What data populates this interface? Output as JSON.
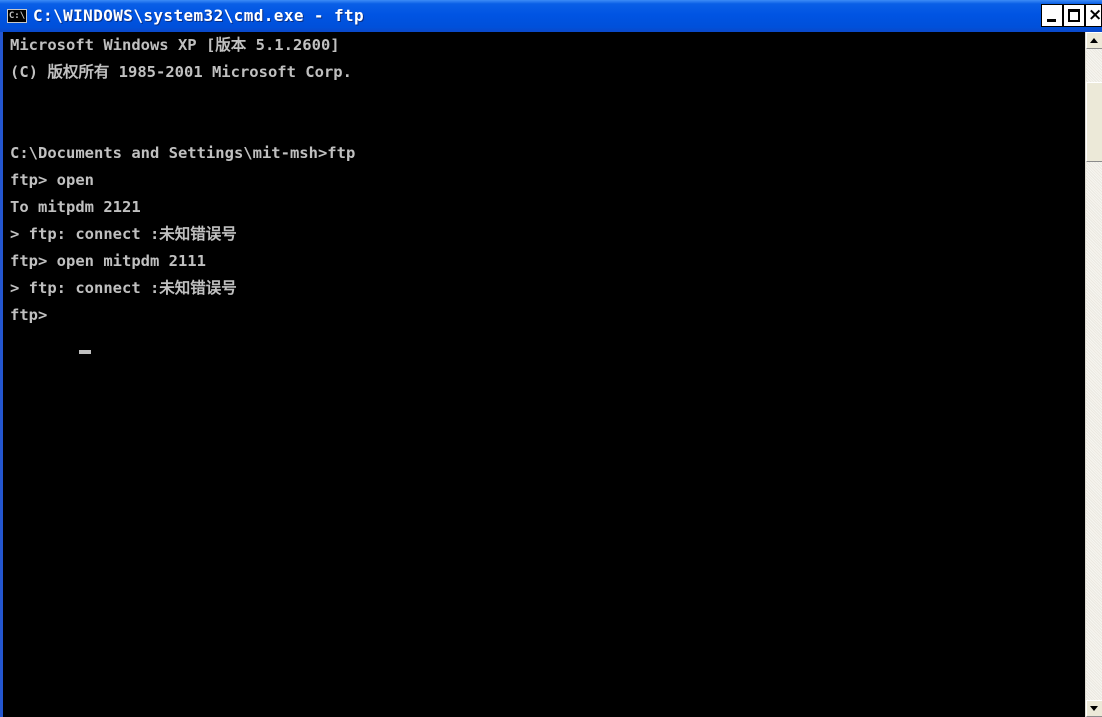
{
  "window": {
    "title": "C:\\WINDOWS\\system32\\cmd.exe - ftp",
    "icon": "cmd-icon",
    "icon_text": "C:\\",
    "title_bar_color": "#0054e3",
    "controls": {
      "minimize": "minimize-icon",
      "maximize": "maximize-icon",
      "close_label": "×"
    }
  },
  "console": {
    "background": "#000000",
    "text_color": "#c0c0c0",
    "lines": [
      "Microsoft Windows XP [版本 5.1.2600]",
      "(C) 版权所有 1985-2001 Microsoft Corp.",
      "",
      "C:\\Documents and Settings\\mit-msh>ftp",
      "ftp> open",
      "To mitpdm 2121",
      "> ftp: connect :未知错误号",
      "ftp> open mitpdm 2111",
      "> ftp: connect :未知错误号",
      "ftp> "
    ]
  },
  "scrollbar": {
    "up_arrow": "arrow-up-icon",
    "down_arrow": "arrow-down-icon"
  }
}
